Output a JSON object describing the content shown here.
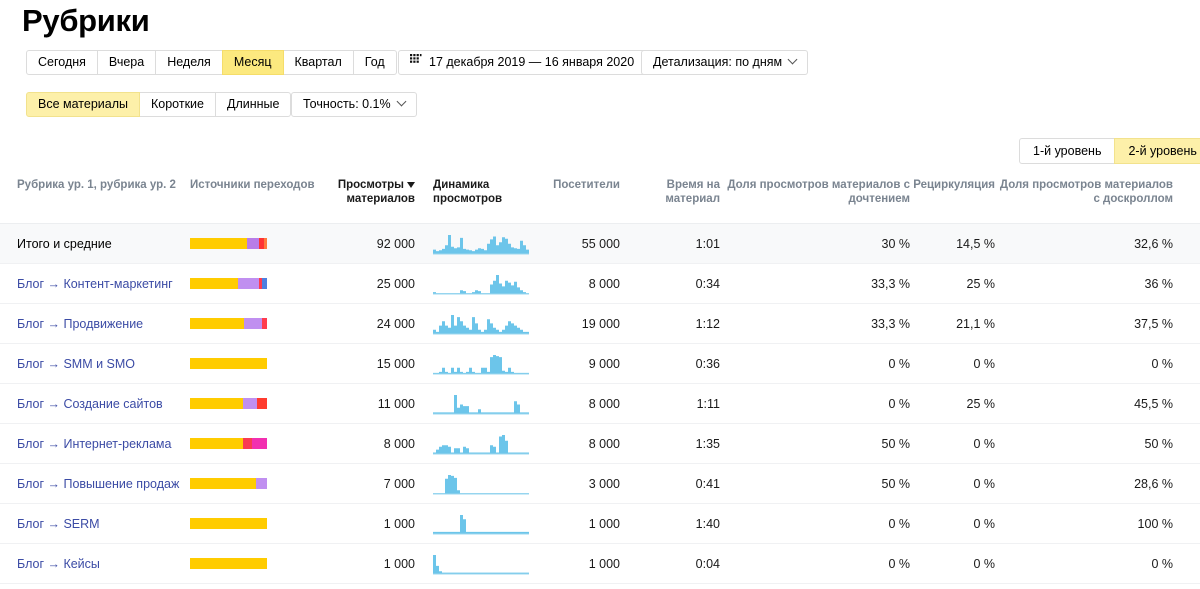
{
  "header": {
    "title": "Рубрики"
  },
  "toolbar": {
    "periods": [
      {
        "label": "Сегодня",
        "active": false
      },
      {
        "label": "Вчера",
        "active": false
      },
      {
        "label": "Неделя",
        "active": false
      },
      {
        "label": "Месяц",
        "active": true
      },
      {
        "label": "Квартал",
        "active": false
      },
      {
        "label": "Год",
        "active": false
      }
    ],
    "date_range": "17 декабря 2019 — 16 января 2020",
    "date_range_icon": "calendar-icon",
    "detail": "Детализация: по дням",
    "detail_icon": "chevron-down-icon",
    "materials": [
      {
        "label": "Все материалы",
        "active": true
      },
      {
        "label": "Короткие",
        "active": false
      },
      {
        "label": "Длинные",
        "active": false
      }
    ],
    "precision": "Точность: 0.1%",
    "precision_icon": "chevron-down-icon",
    "levels": [
      {
        "label": "1-й уровень",
        "active": false
      },
      {
        "label": "2-й уровень",
        "active": true
      }
    ]
  },
  "table": {
    "columns": {
      "name": "Рубрика ур. 1, рубрика ур. 2",
      "sources": "Источники переходов",
      "views": "Просмотры материалов",
      "views_sort_icon": "sort-desc-icon",
      "dynamics": "Динамика просмотров",
      "visitors": "Посетители",
      "time": "Время на материал",
      "read_share": "Доля просмотров материалов с дочтением",
      "recirculation": "Рециркуляция",
      "scroll_share": "Доля просмотров материалов с доскроллом"
    },
    "rows": [
      {
        "name": "Итого и средние",
        "is_total": true,
        "sources": [
          {
            "color": "#fc0",
            "pct": 74
          },
          {
            "color": "#b87de8",
            "pct": 16
          },
          {
            "color": "#ff3333",
            "pct": 6
          },
          {
            "color": "#ff7a3d",
            "pct": 4
          }
        ],
        "views": "92 000",
        "visitors": "55 000",
        "time": "1:01",
        "read_share": "30 %",
        "recirculation": "14,5 %",
        "scroll_share": "32,6 %",
        "spark": [
          6,
          4,
          5,
          7,
          12,
          26,
          10,
          8,
          9,
          22,
          7,
          6,
          5,
          4,
          6,
          8,
          7,
          5,
          14,
          20,
          24,
          12,
          16,
          23,
          21,
          14,
          9,
          8,
          7,
          18,
          12,
          6
        ]
      },
      {
        "name": "Блог → Контент-маркетинг",
        "is_total": false,
        "sources": [
          {
            "color": "#fc0",
            "pct": 62
          },
          {
            "color": "#c08ff0",
            "pct": 27
          },
          {
            "color": "#ff3b4d",
            "pct": 5
          },
          {
            "color": "#4d7fe0",
            "pct": 6
          }
        ],
        "views": "25 000",
        "visitors": "8 000",
        "time": "0:34",
        "read_share": "33,3 %",
        "recirculation": "25 %",
        "scroll_share": "36 %",
        "spark": [
          2,
          1,
          1,
          1,
          1,
          1,
          1,
          1,
          1,
          4,
          3,
          1,
          1,
          2,
          4,
          3,
          1,
          1,
          1,
          10,
          14,
          20,
          11,
          8,
          14,
          12,
          9,
          13,
          7,
          4,
          2,
          1
        ]
      },
      {
        "name": "Блог → Продвижение",
        "is_total": false,
        "sources": [
          {
            "color": "#fc0",
            "pct": 70
          },
          {
            "color": "#c08ff0",
            "pct": 23
          },
          {
            "color": "#ff3b4d",
            "pct": 7
          }
        ],
        "views": "24 000",
        "visitors": "19 000",
        "time": "1:12",
        "read_share": "33,3 %",
        "recirculation": "21,1 %",
        "scroll_share": "37,5 %",
        "spark": [
          2,
          1,
          4,
          6,
          4,
          3,
          9,
          4,
          8,
          6,
          4,
          3,
          2,
          8,
          5,
          2,
          1,
          2,
          7,
          5,
          3,
          2,
          1,
          2,
          4,
          6,
          5,
          4,
          3,
          2,
          1,
          1
        ]
      },
      {
        "name": "Блог → SMM и SMO",
        "is_total": false,
        "sources": [
          {
            "color": "#fc0",
            "pct": 100
          }
        ],
        "views": "15 000",
        "visitors": "9 000",
        "time": "0:36",
        "read_share": "0 %",
        "recirculation": "0 %",
        "scroll_share": "0 %",
        "spark": [
          1,
          1,
          2,
          6,
          2,
          1,
          6,
          2,
          6,
          2,
          1,
          2,
          6,
          2,
          1,
          1,
          6,
          6,
          2,
          16,
          18,
          17,
          16,
          3,
          2,
          6,
          2,
          1,
          1,
          1,
          1,
          1
        ]
      },
      {
        "name": "Блог → Создание сайтов",
        "is_total": false,
        "sources": [
          {
            "color": "#fc0",
            "pct": 69
          },
          {
            "color": "#c08ff0",
            "pct": 18
          },
          {
            "color": "#ff3b2e",
            "pct": 13
          }
        ],
        "views": "11 000",
        "visitors": "8 000",
        "time": "1:11",
        "read_share": "0 %",
        "recirculation": "25 %",
        "scroll_share": "45,5 %",
        "spark": [
          1,
          1,
          1,
          1,
          1,
          1,
          1,
          12,
          4,
          6,
          5,
          5,
          1,
          1,
          1,
          3,
          1,
          1,
          1,
          1,
          1,
          1,
          1,
          1,
          1,
          1,
          1,
          8,
          6,
          1,
          1,
          1
        ]
      },
      {
        "name": "Блог → Интернет-реклама",
        "is_total": false,
        "sources": [
          {
            "color": "#fc0",
            "pct": 69
          },
          {
            "color": "#f93b52",
            "pct": 12
          },
          {
            "color": "#f22fb0",
            "pct": 19
          }
        ],
        "views": "8 000",
        "visitors": "8 000",
        "time": "1:35",
        "read_share": "50 %",
        "recirculation": "0 %",
        "scroll_share": "50 %",
        "spark": [
          1,
          3,
          5,
          6,
          6,
          5,
          1,
          4,
          4,
          1,
          5,
          4,
          1,
          1,
          1,
          1,
          1,
          1,
          1,
          6,
          5,
          1,
          12,
          13,
          9,
          1,
          1,
          1,
          1,
          1,
          1,
          1
        ]
      },
      {
        "name": "Блог → Повышение продаж",
        "is_total": false,
        "sources": [
          {
            "color": "#fc0",
            "pct": 86
          },
          {
            "color": "#c08ff0",
            "pct": 14
          }
        ],
        "views": "7 000",
        "visitors": "3 000",
        "time": "0:41",
        "read_share": "50 %",
        "recirculation": "0 %",
        "scroll_share": "28,6 %",
        "spark": [
          1,
          1,
          1,
          1,
          16,
          20,
          19,
          17,
          4,
          1,
          1,
          1,
          1,
          1,
          1,
          1,
          1,
          1,
          1,
          1,
          1,
          1,
          1,
          1,
          1,
          1,
          1,
          1,
          1,
          1,
          1,
          1
        ]
      },
      {
        "name": "Блог → SERM",
        "is_total": false,
        "sources": [
          {
            "color": "#fc0",
            "pct": 100
          }
        ],
        "views": "1 000",
        "visitors": "1 000",
        "time": "1:40",
        "read_share": "0 %",
        "recirculation": "0 %",
        "scroll_share": "100 %",
        "spark": [
          1,
          1,
          1,
          1,
          1,
          1,
          1,
          1,
          1,
          9,
          7,
          1,
          1,
          1,
          1,
          1,
          1,
          1,
          1,
          1,
          1,
          1,
          1,
          1,
          1,
          1,
          1,
          1,
          1,
          1,
          1,
          1
        ]
      },
      {
        "name": "Блог → Кейсы",
        "is_total": false,
        "sources": [
          {
            "color": "#fc0",
            "pct": 100
          }
        ],
        "views": "1 000",
        "visitors": "1 000",
        "time": "0:04",
        "read_share": "0 %",
        "recirculation": "0 %",
        "scroll_share": "0 %",
        "spark": [
          14,
          6,
          2,
          1,
          1,
          1,
          1,
          1,
          1,
          1,
          1,
          1,
          1,
          1,
          1,
          1,
          1,
          1,
          1,
          1,
          1,
          1,
          1,
          1,
          1,
          1,
          1,
          1,
          1,
          1,
          1,
          1
        ]
      }
    ]
  },
  "colors": {
    "accent": "#fce97f",
    "link": "#3b4ba5",
    "spark": "#64c3ea",
    "bar_primary": "#ffcc00"
  }
}
